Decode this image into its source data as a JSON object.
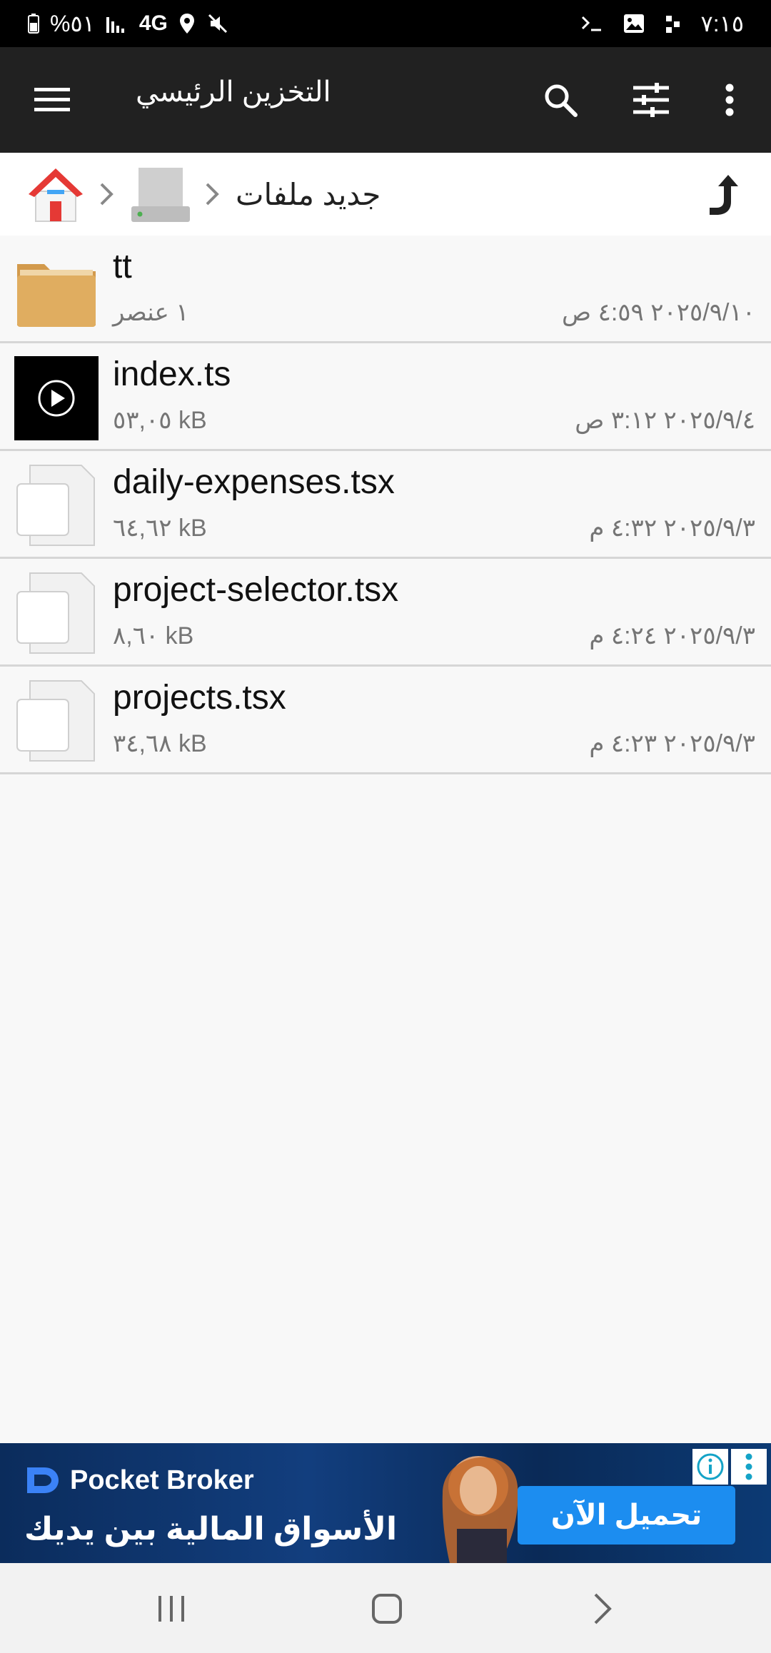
{
  "status_bar": {
    "battery_text": "%٥١",
    "network_text": "4G",
    "time": "٧:١٥"
  },
  "app_bar": {
    "title": "التخزين الرئيسي",
    "icons": [
      "menu-icon",
      "search-icon",
      "sliders-icon",
      "more-vert-icon"
    ]
  },
  "breadcrumb": {
    "folder_label": "جديد ملفات",
    "icons": [
      "home-icon",
      "chevron-right-icon",
      "drive-icon",
      "chevron-right-icon",
      "up-arrow-icon"
    ]
  },
  "files": [
    {
      "name": "tt",
      "detail": "١ عنصر",
      "date": "٢٠٢٥/٩/١٠ ٤:٥٩ ص",
      "type": "folder"
    },
    {
      "name": "index.ts",
      "detail": "٥٣,٠٥ kB",
      "date": "٢٠٢٥/٩/٤ ٣:١٢ ص",
      "type": "video"
    },
    {
      "name": "daily-expenses.tsx",
      "detail": "٦٤,٦٢ kB",
      "date": "٢٠٢٥/٩/٣ ٤:٣٢ م",
      "type": "file"
    },
    {
      "name": "project-selector.tsx",
      "detail": "٨,٦٠ kB",
      "date": "٢٠٢٥/٩/٣ ٤:٢٤ م",
      "type": "file"
    },
    {
      "name": "projects.tsx",
      "detail": "٣٤,٦٨ kB",
      "date": "٢٠٢٥/٩/٣ ٤:٢٣ م",
      "type": "file"
    }
  ],
  "ad": {
    "brand": "Pocket Broker",
    "tagline": "الأسواق المالية بين يديك",
    "cta": "تحميل الآن",
    "colors": {
      "background": "#0b2c5c",
      "cta": "#1c8df0"
    }
  },
  "colors": {
    "app_bar": "#212121",
    "folder": "#e0ad60",
    "home_roof": "#e53935"
  }
}
